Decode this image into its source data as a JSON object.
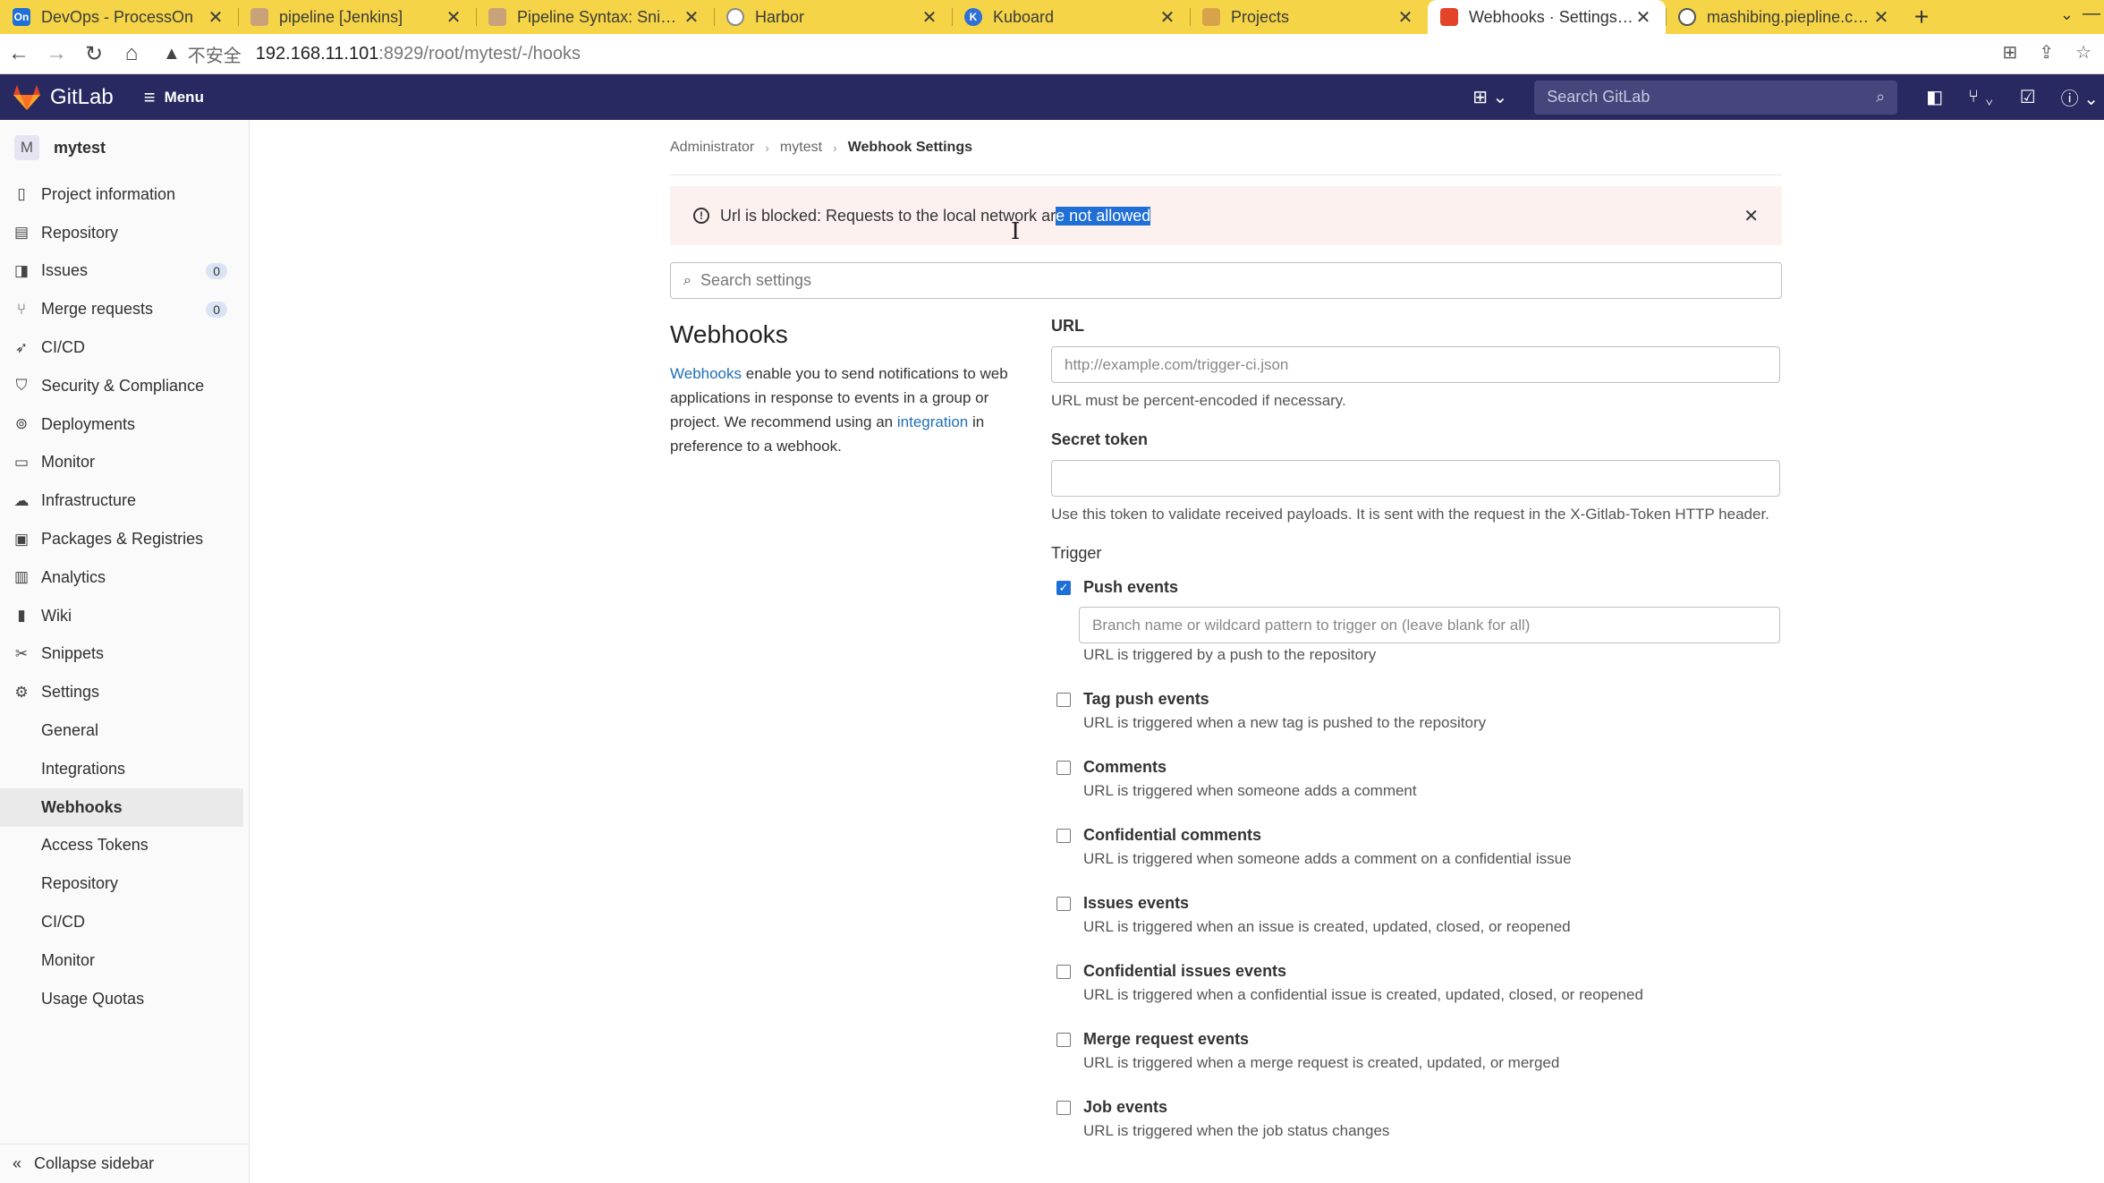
{
  "browser": {
    "tabs": [
      {
        "title": "DevOps - ProcessOn",
        "favicon": "processon-icon",
        "favicon_text": "On",
        "favicon_color": "#1f6fd6"
      },
      {
        "title": "pipeline [Jenkins]",
        "favicon": "jenkins-icon",
        "favicon_text": "",
        "favicon_color": "#c9a27a"
      },
      {
        "title": "Pipeline Syntax: Snippet",
        "favicon": "jenkins-icon",
        "favicon_text": "",
        "favicon_color": "#c9a27a"
      },
      {
        "title": "Harbor",
        "favicon": "harbor-icon",
        "favicon_text": "",
        "favicon_color": "#8a8a8a"
      },
      {
        "title": "Kuboard",
        "favicon": "kuboard-icon",
        "favicon_text": "K",
        "favicon_color": "#2f6fd6"
      },
      {
        "title": "Projects",
        "favicon": "gitlab-icon",
        "favicon_text": "",
        "favicon_color": "#d8a24a"
      },
      {
        "title": "Webhooks · Settings · A",
        "favicon": "gitlab-icon",
        "favicon_text": "",
        "favicon_color": "#e24329",
        "active": true
      },
      {
        "title": "mashibing.piepline.com",
        "favicon": "globe-icon",
        "favicon_text": "",
        "favicon_color": "#555555"
      }
    ],
    "address": {
      "security_label": "不安全",
      "host": "192.168.11.101",
      "path": ":8929/root/mytest/-/hooks"
    }
  },
  "topnav": {
    "brand": "GitLab",
    "menu_label": "Menu",
    "search_placeholder": "Search GitLab",
    "bg_color": "#292961"
  },
  "sidebar": {
    "project_initial": "M",
    "project_name": "mytest",
    "items": [
      {
        "label": "Project information",
        "icon": "document-icon"
      },
      {
        "label": "Repository",
        "icon": "repository-icon"
      },
      {
        "label": "Issues",
        "icon": "issues-icon",
        "badge": "0"
      },
      {
        "label": "Merge requests",
        "icon": "merge-request-icon",
        "badge": "0"
      },
      {
        "label": "CI/CD",
        "icon": "rocket-icon"
      },
      {
        "label": "Security & Compliance",
        "icon": "shield-icon"
      },
      {
        "label": "Deployments",
        "icon": "deployments-icon"
      },
      {
        "label": "Monitor",
        "icon": "monitor-icon"
      },
      {
        "label": "Infrastructure",
        "icon": "cloud-icon"
      },
      {
        "label": "Packages & Registries",
        "icon": "package-icon"
      },
      {
        "label": "Analytics",
        "icon": "chart-icon"
      },
      {
        "label": "Wiki",
        "icon": "book-icon"
      },
      {
        "label": "Snippets",
        "icon": "scissors-icon"
      },
      {
        "label": "Settings",
        "icon": "gear-icon"
      }
    ],
    "settings_subitems": [
      {
        "label": "General"
      },
      {
        "label": "Integrations"
      },
      {
        "label": "Webhooks",
        "active": true
      },
      {
        "label": "Access Tokens"
      },
      {
        "label": "Repository"
      },
      {
        "label": "CI/CD"
      },
      {
        "label": "Monitor"
      },
      {
        "label": "Usage Quotas"
      }
    ],
    "collapse_label": "Collapse sidebar"
  },
  "breadcrumb": [
    "Administrator",
    "mytest",
    "Webhook Settings"
  ],
  "alert": {
    "text_before": "Url is blocked: Requests to the local network ar",
    "text_selected": "e not allowed"
  },
  "search_settings_placeholder": "Search settings",
  "webhooks": {
    "heading": "Webhooks",
    "desc_link1": "Webhooks",
    "desc_mid": " enable you to send notifications to web applications in response to events in a group or project. We recommend using an ",
    "desc_link2": "integration",
    "desc_end": " in preference to a webhook."
  },
  "form": {
    "url_label": "URL",
    "url_placeholder": "http://example.com/trigger-ci.json",
    "url_help": "URL must be percent-encoded if necessary.",
    "secret_label": "Secret token",
    "secret_help": "Use this token to validate received payloads. It is sent with the request in the X-Gitlab-Token HTTP header.",
    "trigger_label": "Trigger",
    "push": {
      "name": "Push events",
      "checked": true,
      "branch_placeholder": "Branch name or wildcard pattern to trigger on (leave blank for all)",
      "desc": "URL is triggered by a push to the repository"
    },
    "triggers": [
      {
        "name": "Tag push events",
        "desc": "URL is triggered when a new tag is pushed to the repository"
      },
      {
        "name": "Comments",
        "desc": "URL is triggered when someone adds a comment"
      },
      {
        "name": "Confidential comments",
        "desc": "URL is triggered when someone adds a comment on a confidential issue"
      },
      {
        "name": "Issues events",
        "desc": "URL is triggered when an issue is created, updated, closed, or reopened"
      },
      {
        "name": "Confidential issues events",
        "desc": "URL is triggered when a confidential issue is created, updated, closed, or reopened"
      },
      {
        "name": "Merge request events",
        "desc": "URL is triggered when a merge request is created, updated, or merged"
      },
      {
        "name": "Job events",
        "desc": "URL is triggered when the job status changes"
      }
    ]
  }
}
